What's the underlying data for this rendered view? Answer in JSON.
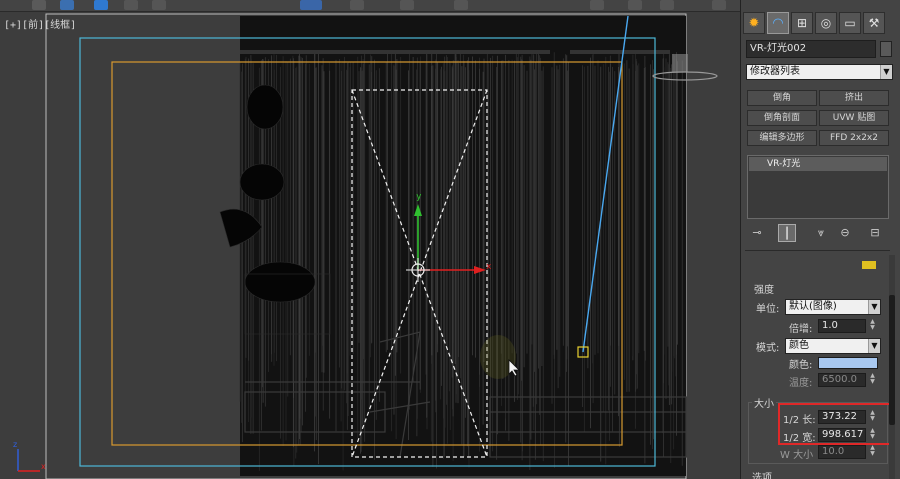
{
  "viewport": {
    "label": "[+][前][线框]",
    "gizmo_y": "y",
    "gizmo_x": "x",
    "axis_x": "x",
    "axis_z": "z"
  },
  "panel": {
    "object_name": "VR-灯光002",
    "modifier_list": "修改器列表",
    "modifiers": [
      "倒角",
      "挤出",
      "倒角剖面",
      "UVW 贴图",
      "编辑多边形",
      "FFD 2x2x2"
    ],
    "stack_item": "VR-灯光",
    "intensity": {
      "title": "强度",
      "unit_label": "单位:",
      "unit_value": "默认(图像)",
      "multiplier_label": "倍增:",
      "multiplier_value": "1.0",
      "mode_label": "模式:",
      "mode_value": "颜色",
      "color_label": "颜色:",
      "temperature_label": "温度:",
      "temperature_value": "6500.0"
    },
    "size": {
      "title": "大小",
      "half_length_label": "1/2 长:",
      "half_length_value": "373.22",
      "half_width_label": "1/2 宽:",
      "half_width_value": "998.617",
      "w_size_label": "W 大小",
      "w_size_value": "10.0"
    },
    "options_title": "选项"
  },
  "colors": {
    "light_color": "#a8c8f0",
    "highlight_box": "#e02828",
    "safe_frame_outer": "#4db8d8",
    "safe_frame_inner": "#d89a30"
  }
}
